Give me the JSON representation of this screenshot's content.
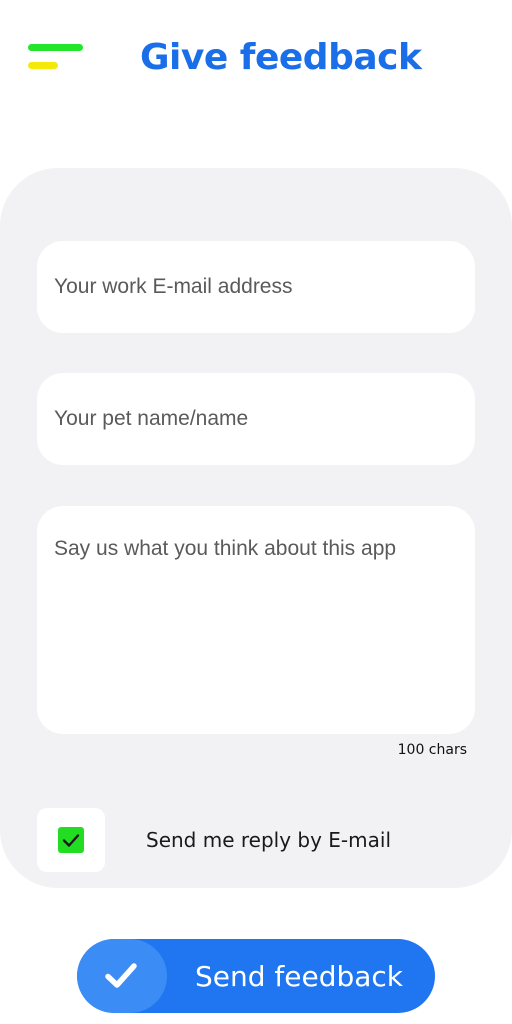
{
  "colors": {
    "accent_blue": "#1a6fe8",
    "button_blue": "#1f76f0",
    "button_circle_blue": "#3c8cf6",
    "menu_green": "#24e52b",
    "menu_yellow": "#f3ea0c",
    "checkbox_green": "#22dd22",
    "card_gray": "#f2f2f4"
  },
  "header": {
    "title": "Give feedback",
    "menu_icon": "hamburger-menu-icon"
  },
  "form": {
    "email": {
      "value": "",
      "placeholder": "Your work E-mail address"
    },
    "name": {
      "value": "",
      "placeholder": "Your pet name/name"
    },
    "message": {
      "value": "",
      "placeholder": "Say us what you think about this app",
      "char_count": "100 chars"
    },
    "reply": {
      "checked": true,
      "label": "Send me reply by E-mail",
      "icon": "checkmark-icon"
    }
  },
  "submit": {
    "label": "Send feedback",
    "icon": "checkmark-icon"
  }
}
